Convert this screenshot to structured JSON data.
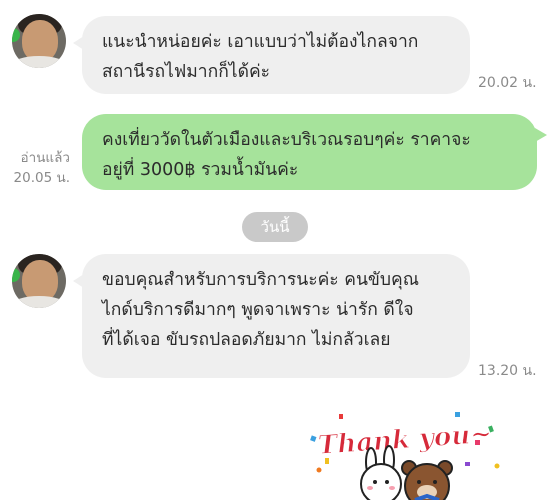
{
  "messages": [
    {
      "lines": [
        "แนะนำหน่อยค่ะ เอาแบบว่าไม่ต้องไกลจาก",
        "สถานีรถไฟมากก็ได้ค่ะ"
      ],
      "time": "20.02 น."
    },
    {
      "lines": [
        "คงเที่ยววัดในตัวเมืองและบริเวณรอบๆค่ะ ราคาจะ",
        "อยู่ที่ 3000฿ รวมน้ำมันค่ะ"
      ],
      "read_lines": [
        "อ่านแล้ว",
        "20.05 น."
      ]
    },
    {
      "lines": [
        "ขอบคุณสำหรับการบริการนะค่ะ คนขับคุณ",
        "ไกด์บริการดีมากๆ พูดจาเพราะ น่ารัก ดีใจ",
        "ที่ได้เจอ ขับรถปลอดภัยมาก ไม่กลัวเลย"
      ],
      "time": "13.20 น."
    }
  ],
  "date_separator": "วันนี้",
  "sticker": {
    "text": "Thank you~"
  },
  "colors": {
    "incoming": "#efefef",
    "outgoing": "#a6e39b",
    "date_pill": "#c9c9c9"
  }
}
